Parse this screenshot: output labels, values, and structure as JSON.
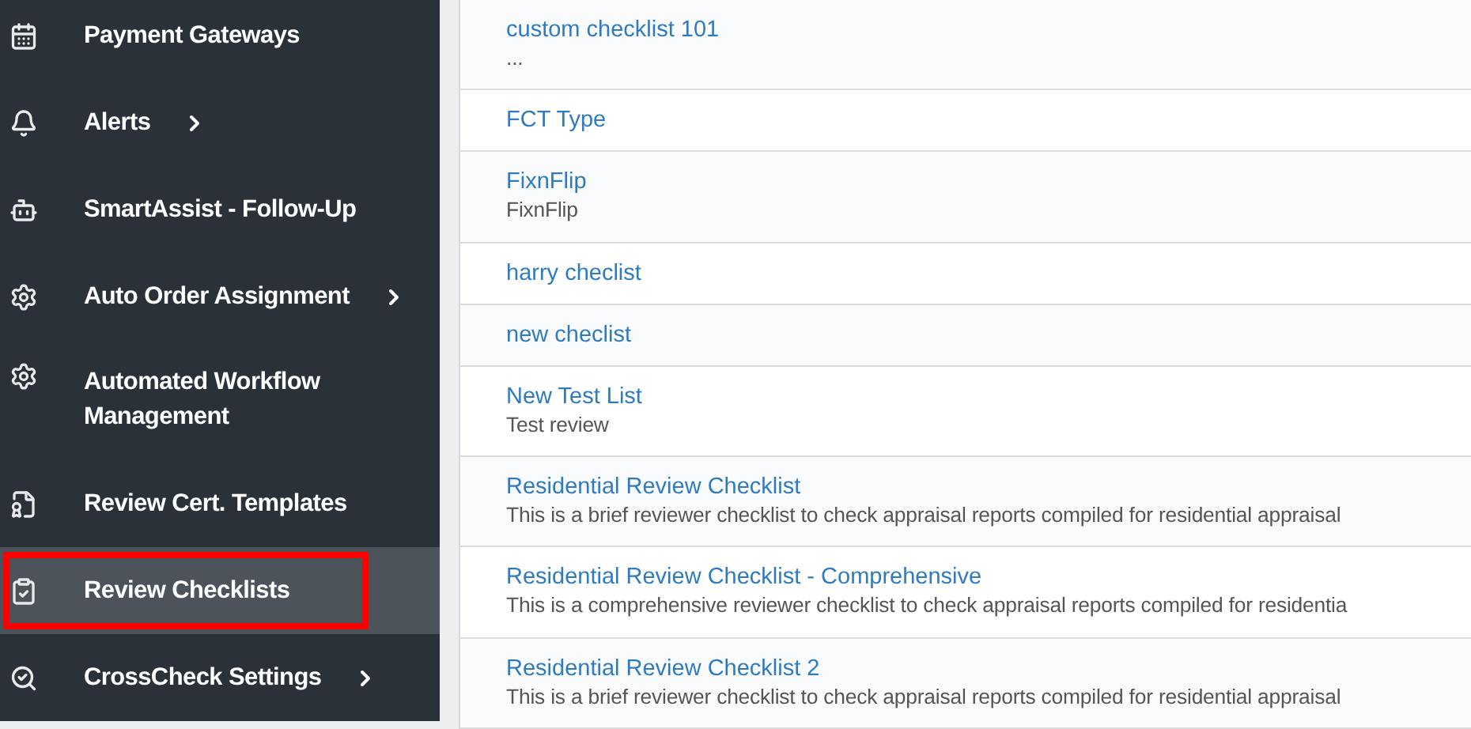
{
  "sidebar": {
    "items": [
      {
        "label": "Payment Gateways",
        "has_submenu": false,
        "selected": false,
        "highlighted": false
      },
      {
        "label": "Alerts",
        "has_submenu": true,
        "selected": false,
        "highlighted": false
      },
      {
        "label": "SmartAssist - Follow-Up",
        "has_submenu": false,
        "selected": false,
        "highlighted": false
      },
      {
        "label": "Auto Order Assignment",
        "has_submenu": true,
        "selected": false,
        "highlighted": false
      },
      {
        "label": "Automated Workflow Management",
        "has_submenu": false,
        "selected": false,
        "highlighted": false
      },
      {
        "label": "Review Cert. Templates",
        "has_submenu": false,
        "selected": false,
        "highlighted": false
      },
      {
        "label": "Review Checklists",
        "has_submenu": false,
        "selected": true,
        "highlighted": true
      },
      {
        "label": "CrossCheck Settings",
        "has_submenu": true,
        "selected": false,
        "highlighted": false
      }
    ]
  },
  "checklists": [
    {
      "title": "custom checklist 101",
      "description": "..."
    },
    {
      "title": "FCT Type"
    },
    {
      "title": "FixnFlip",
      "description": "FixnFlip"
    },
    {
      "title": "harry checlist"
    },
    {
      "title": "new checlist"
    },
    {
      "title": "New Test List",
      "description": "Test review"
    },
    {
      "title": "Residential Review Checklist",
      "description": "This is a brief reviewer checklist to check appraisal reports compiled for residential appraisal"
    },
    {
      "title": "Residential Review Checklist - Comprehensive",
      "description": "This is a comprehensive reviewer checklist to check appraisal reports compiled for residentia"
    },
    {
      "title": "Residential Review Checklist 2",
      "description": "This is a brief reviewer checklist to check appraisal reports compiled for residential appraisal"
    }
  ]
}
